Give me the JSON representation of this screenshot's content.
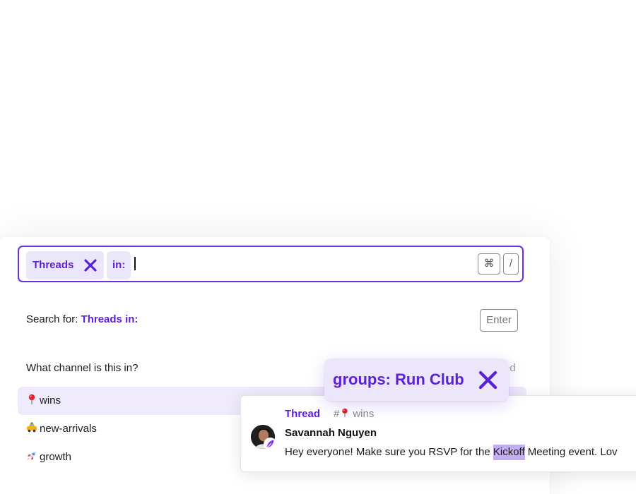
{
  "search": {
    "chips": [
      {
        "label": "Threads",
        "removable": true
      },
      {
        "label": "in:",
        "removable": false
      }
    ],
    "shortcut_keys": [
      "⌘",
      "/"
    ]
  },
  "search_for": {
    "prefix": "Search for: ",
    "query": "Threads in:",
    "key_hint": "Enter"
  },
  "channel_section": {
    "question": "What channel is this in?",
    "partial_right_text": "ed",
    "channels": [
      {
        "emoji": "pin-icon",
        "name": "wins",
        "selected": true
      },
      {
        "emoji": "taxi-icon",
        "name": "new-arrivals",
        "selected": false
      },
      {
        "emoji": "rocket-icon",
        "name": "growth",
        "selected": false
      }
    ]
  },
  "floating_chip": {
    "label": "groups: Run Club"
  },
  "thread_card": {
    "type_label": "Thread",
    "channel_hash": "#",
    "channel_name": "wins",
    "author": "Savannah Nguyen",
    "message_before": "Hey everyone! Make sure you RSVP for the ",
    "message_highlight": "Kickoff",
    "message_after": " Meeting event. Lov"
  },
  "colors": {
    "accent": "#5b21d6",
    "chip_bg": "#ece6fb",
    "selected_row_bg": "#efeafc",
    "highlight": "#c4aef2"
  }
}
